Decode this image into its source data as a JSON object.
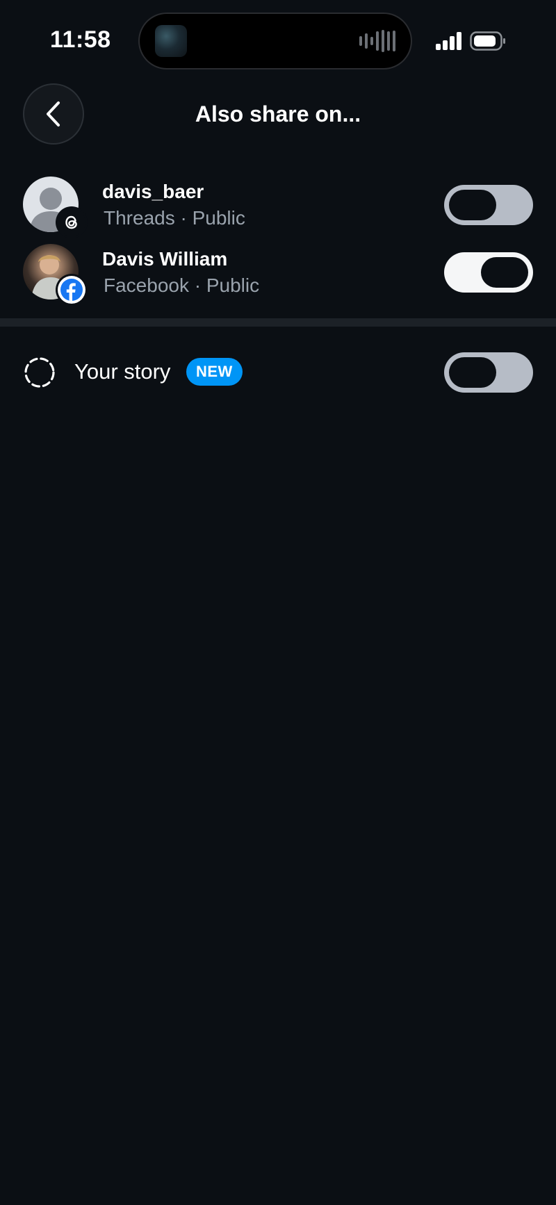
{
  "status_bar": {
    "time": "11:58"
  },
  "header": {
    "title": "Also share on...",
    "back_icon": "chevron-left-icon"
  },
  "accounts": [
    {
      "name": "davis_baer",
      "subtitle": "Threads · Public",
      "platform_icon": "threads-icon",
      "enabled": false
    },
    {
      "name": "Davis William",
      "subtitle": "Facebook · Public",
      "platform_icon": "facebook-icon",
      "enabled": true
    }
  ],
  "story": {
    "label": "Your story",
    "badge": "NEW",
    "icon": "story-ring-icon",
    "enabled": false
  },
  "colors": {
    "background": "#0b0f14",
    "toggle_off": "#b6bcc6",
    "toggle_on": "#f5f6f7",
    "new_badge": "#0095f6",
    "facebook_blue": "#1877f2",
    "subtitle": "#9aa3ad"
  }
}
